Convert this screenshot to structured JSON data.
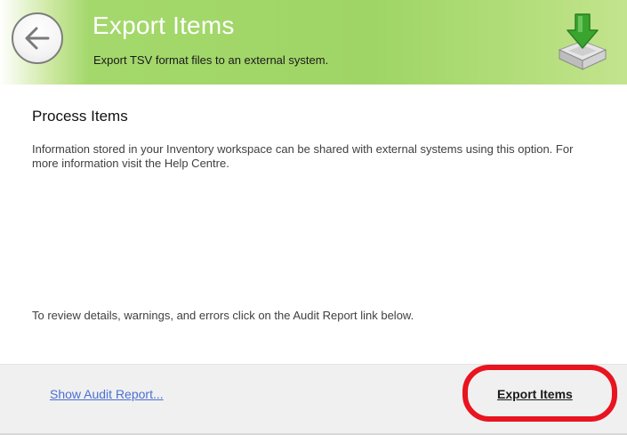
{
  "header": {
    "title": "Export Items",
    "subtitle": "Export TSV format files to an external system.",
    "back_icon": "back-arrow-icon",
    "export_icon": "export-tray-icon",
    "accent": "#9fd566"
  },
  "content": {
    "section_title": "Process Items",
    "description": "Information stored in your Inventory workspace can be shared with external systems using this option. For more information visit the Help Centre.",
    "review_note": "To review details, warnings, and errors click on the Audit Report link below."
  },
  "footer": {
    "audit_link": "Show Audit Report...",
    "export_button": "Export Items",
    "link_color": "#4b6fd3",
    "highlight_color": "#e8141f"
  }
}
